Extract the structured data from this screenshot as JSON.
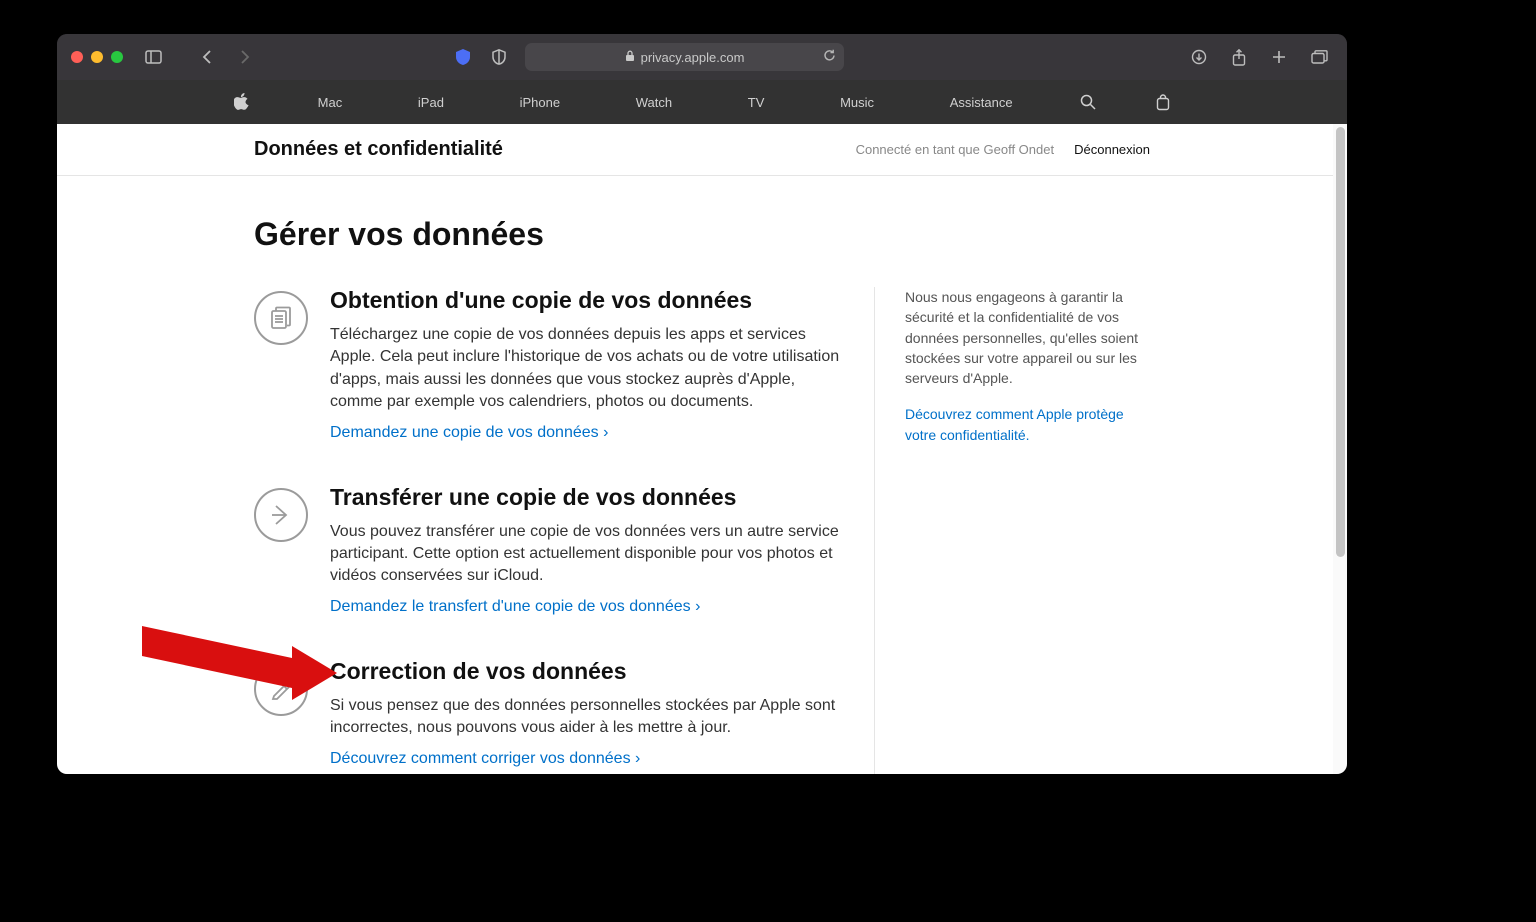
{
  "browser": {
    "url_host": "privacy.apple.com"
  },
  "gnav": {
    "items": [
      "Mac",
      "iPad",
      "iPhone",
      "Watch",
      "TV",
      "Music",
      "Assistance"
    ]
  },
  "local_header": {
    "title": "Données et confidentialité",
    "signed_in": "Connecté en tant que Geoff Ondet",
    "signout": "Déconnexion"
  },
  "page": {
    "heading": "Gérer vos données",
    "sidebar": {
      "text": "Nous nous engageons à garantir la sécurité et la confidentialité de vos données personnelles, qu'elles soient stockées sur votre appareil ou sur les serveurs d'Apple.",
      "link": "Découvrez comment Apple protège votre confidentialité."
    },
    "sections": [
      {
        "title": "Obtention d'une copie de vos données",
        "body": "Téléchargez une copie de vos données depuis les apps et services Apple. Cela peut inclure l'historique de vos achats ou de votre utilisation d'apps, mais aussi les données que vous stockez auprès d'Apple, comme par exemple vos calendriers, photos ou documents.",
        "link": "Demandez une copie de vos données"
      },
      {
        "title": "Transférer une copie de vos données",
        "body": "Vous pouvez transférer une copie de vos données vers un autre service participant. Cette option est actuellement disponible pour vos photos et vidéos conservées sur iCloud.",
        "link": "Demandez le transfert d'une copie de vos données"
      },
      {
        "title": "Correction de vos données",
        "body": "Si vous pensez que des données personnelles stockées par Apple sont incorrectes, nous pouvons vous aider à les mettre à jour.",
        "link": "Découvrez comment corriger vos données"
      }
    ]
  }
}
